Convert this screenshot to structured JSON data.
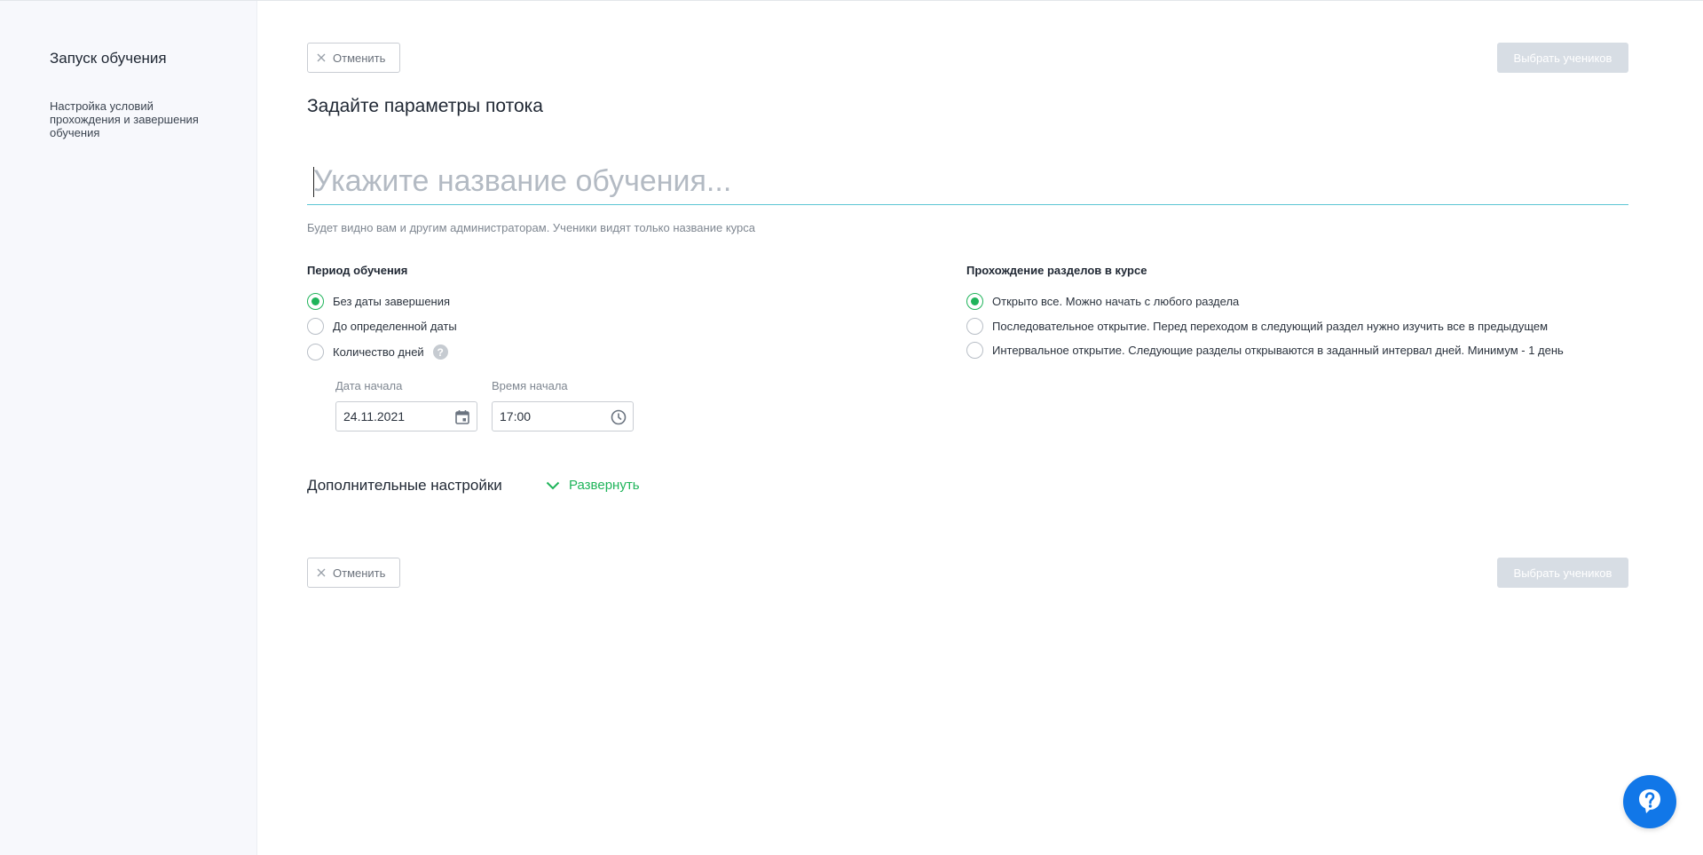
{
  "sidebar": {
    "title": "Запуск обучения",
    "subtitle": "Настройка условий прохождения и завершения обучения"
  },
  "toolbar": {
    "cancel_label": "Отменить",
    "select_students_label": "Выбрать учеников"
  },
  "page": {
    "heading": "Задайте параметры потока",
    "name_placeholder": "Укажите название обучения...",
    "name_value": "",
    "hint": "Будет видно вам и другим администраторам. Ученики видят только название курса"
  },
  "period": {
    "title": "Период обучения",
    "options": [
      {
        "label": "Без даты завершения",
        "checked": true
      },
      {
        "label": "До определенной даты",
        "checked": false
      },
      {
        "label": "Количество дней",
        "checked": false
      }
    ],
    "start_date_label": "Дата начала",
    "start_date_value": "24.11.2021",
    "start_time_label": "Время начала",
    "start_time_value": "17:00"
  },
  "sections": {
    "title": "Прохождение разделов в курсе",
    "options": [
      {
        "label": "Открыто все. Можно начать с любого раздела",
        "checked": true
      },
      {
        "label": "Последовательное открытие. Перед переходом в следующий раздел нужно изучить все в предыдущем",
        "checked": false
      },
      {
        "label": "Интервальное открытие. Следующие разделы открываются в заданный интервал дней. Минимум - 1 день",
        "checked": false
      }
    ]
  },
  "extra": {
    "title": "Дополнительные настройки",
    "expand_label": "Развернуть"
  },
  "help_icon": "?",
  "colors": {
    "accent": "#1fb45a",
    "input_underline": "#5cc6d4",
    "disabled_button": "#d7dde4",
    "help_fab": "#1177e8"
  },
  "icons": {
    "cancel": "close-icon",
    "date": "calendar-icon",
    "time": "clock-icon",
    "expand": "chevron-down-icon",
    "fab": "question-icon"
  }
}
